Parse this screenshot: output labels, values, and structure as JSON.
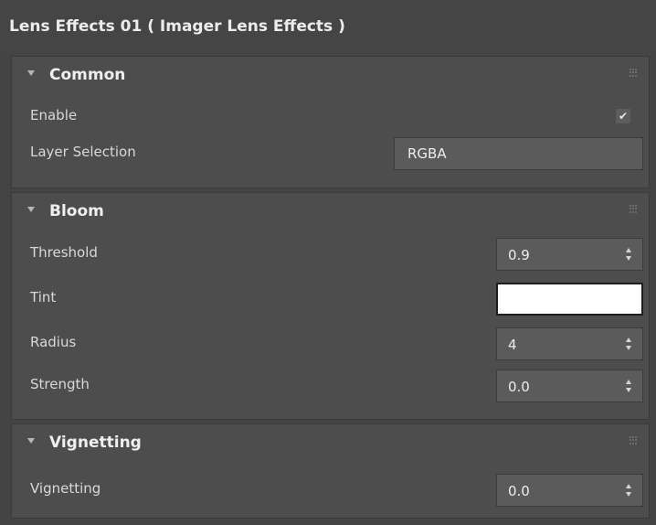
{
  "window": {
    "title": "Lens Effects 01 ( Imager Lens Effects )"
  },
  "common": {
    "header": "Common",
    "enable_label": "Enable",
    "enable_checked": true,
    "checkmark_glyph": "✔",
    "layer_selection_label": "Layer Selection",
    "layer_selection_value": "RGBA"
  },
  "bloom": {
    "header": "Bloom",
    "threshold_label": "Threshold",
    "threshold_value": "0.9",
    "tint_label": "Tint",
    "tint_color": "#ffffff",
    "radius_label": "Radius",
    "radius_value": "4",
    "strength_label": "Strength",
    "strength_value": "0.0"
  },
  "vignetting": {
    "header": "Vignetting",
    "vignetting_label": "Vignetting",
    "vignetting_value": "0.0"
  },
  "icons": {
    "collapse": "triangle-down",
    "grip": "drag-grip",
    "spinner": "up-down-arrows",
    "checkbox": "checkmark"
  }
}
